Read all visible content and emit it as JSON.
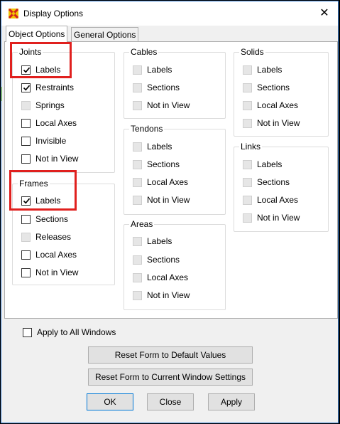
{
  "window": {
    "title": "Display Options",
    "close_glyph": "✕"
  },
  "tabs": [
    {
      "label": "Object Options",
      "active": true
    },
    {
      "label": "General Options",
      "active": false
    }
  ],
  "groups": {
    "joints": {
      "title": "Joints",
      "options": [
        {
          "label": "Labels",
          "checked": true,
          "enabled": true
        },
        {
          "label": "Restraints",
          "checked": true,
          "enabled": true
        },
        {
          "label": "Springs",
          "checked": false,
          "enabled": false
        },
        {
          "label": "Local Axes",
          "checked": false,
          "enabled": true
        },
        {
          "label": "Invisible",
          "checked": false,
          "enabled": true
        },
        {
          "label": "Not in View",
          "checked": false,
          "enabled": true
        }
      ]
    },
    "frames": {
      "title": "Frames",
      "options": [
        {
          "label": "Labels",
          "checked": true,
          "enabled": true
        },
        {
          "label": "Sections",
          "checked": false,
          "enabled": true
        },
        {
          "label": "Releases",
          "checked": false,
          "enabled": false
        },
        {
          "label": "Local Axes",
          "checked": false,
          "enabled": true
        },
        {
          "label": "Not in View",
          "checked": false,
          "enabled": true
        }
      ]
    },
    "cables": {
      "title": "Cables",
      "options": [
        {
          "label": "Labels",
          "checked": false,
          "enabled": false
        },
        {
          "label": "Sections",
          "checked": false,
          "enabled": false
        },
        {
          "label": "Not in View",
          "checked": false,
          "enabled": false
        }
      ]
    },
    "tendons": {
      "title": "Tendons",
      "options": [
        {
          "label": "Labels",
          "checked": false,
          "enabled": false
        },
        {
          "label": "Sections",
          "checked": false,
          "enabled": false
        },
        {
          "label": "Local Axes",
          "checked": false,
          "enabled": false
        },
        {
          "label": "Not in View",
          "checked": false,
          "enabled": false
        }
      ]
    },
    "areas": {
      "title": "Areas",
      "options": [
        {
          "label": "Labels",
          "checked": false,
          "enabled": false
        },
        {
          "label": "Sections",
          "checked": false,
          "enabled": false
        },
        {
          "label": "Local Axes",
          "checked": false,
          "enabled": false
        },
        {
          "label": "Not in View",
          "checked": false,
          "enabled": false
        }
      ]
    },
    "solids": {
      "title": "Solids",
      "options": [
        {
          "label": "Labels",
          "checked": false,
          "enabled": false
        },
        {
          "label": "Sections",
          "checked": false,
          "enabled": false
        },
        {
          "label": "Local Axes",
          "checked": false,
          "enabled": false
        },
        {
          "label": "Not in View",
          "checked": false,
          "enabled": false
        }
      ]
    },
    "links": {
      "title": "Links",
      "options": [
        {
          "label": "Labels",
          "checked": false,
          "enabled": false
        },
        {
          "label": "Sections",
          "checked": false,
          "enabled": false
        },
        {
          "label": "Local Axes",
          "checked": false,
          "enabled": false
        },
        {
          "label": "Not in View",
          "checked": false,
          "enabled": false
        }
      ]
    }
  },
  "apply_all": {
    "label": "Apply to All Windows",
    "checked": false
  },
  "buttons": {
    "reset_default": "Reset Form to Default Values",
    "reset_current": "Reset Form to Current Window Settings",
    "ok": "OK",
    "close": "Close",
    "apply": "Apply"
  },
  "colors": {
    "highlight": "#e0201e",
    "window_border": "#3a7fd0"
  },
  "icons": {
    "app": "app-logo-icon",
    "close": "close-icon",
    "check": "checkmark-icon"
  }
}
